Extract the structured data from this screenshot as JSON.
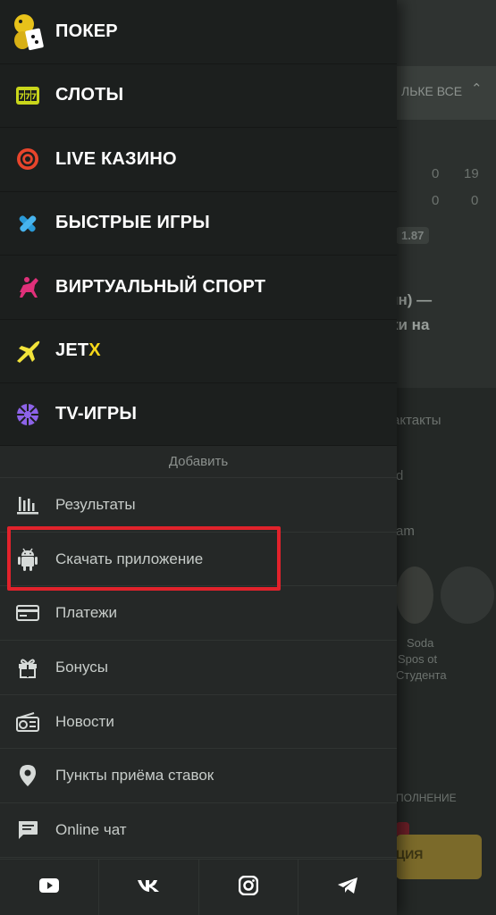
{
  "background": {
    "texts": [
      "ЛЬКЕ ВСЕ",
      "0",
      "0",
      "0",
      "19",
      "1.87",
      "йн) —",
      "ки на",
      "актакты",
      "d",
      "am",
      "Soda",
      "Spos ot",
      "Студента",
      "ПОЛНЕНИЕ",
      "ЦИЯ"
    ]
  },
  "menu": {
    "main": [
      {
        "label": "ПОКЕР",
        "icon": "poker-cards-icon"
      },
      {
        "label": "СЛОТЫ",
        "icon": "slot-machine-icon"
      },
      {
        "label": "LIVE КАЗИНО",
        "icon": "live-casino-icon"
      },
      {
        "label": "БЫСТРЫЕ ИГРЫ",
        "icon": "fast-games-icon"
      },
      {
        "label": "ВИРТУАЛЬНЫЙ СПОРТ",
        "icon": "horse-racing-icon"
      },
      {
        "label": "JET",
        "suffix": "X",
        "icon": "jet-plane-icon"
      },
      {
        "label": "TV-ИГРЫ",
        "icon": "tv-games-icon"
      }
    ],
    "add_label": "Добавить",
    "secondary": [
      {
        "label": "Результаты",
        "icon": "results-chart-icon"
      },
      {
        "label": "Скачать приложение",
        "icon": "android-icon"
      },
      {
        "label": "Платежи",
        "icon": "credit-card-icon"
      },
      {
        "label": "Бонусы",
        "icon": "gift-icon"
      },
      {
        "label": "Новости",
        "icon": "radio-news-icon"
      },
      {
        "label": "Пункты приёма ставок",
        "icon": "location-pin-icon"
      },
      {
        "label": "Online чат",
        "icon": "chat-icon"
      }
    ],
    "social": [
      "youtube-icon",
      "vk-icon",
      "instagram-icon",
      "telegram-icon"
    ]
  },
  "colors": {
    "highlight": "#e1222b",
    "jet_accent": "#f7d81a",
    "drawer_bg": "#1c1f1e",
    "secondary_bg": "#252827"
  }
}
